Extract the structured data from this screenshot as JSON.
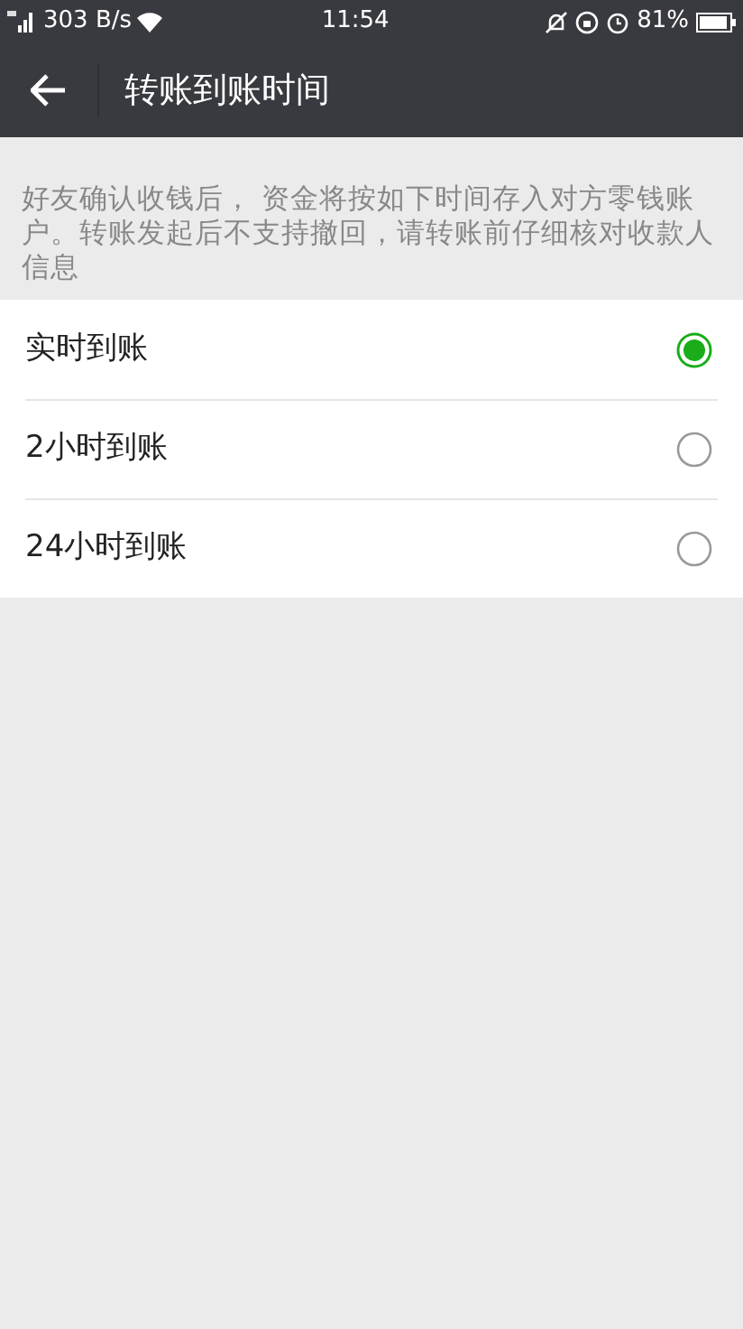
{
  "status_bar": {
    "speed": "303 B/s",
    "time": "11:54",
    "battery": "81%"
  },
  "header": {
    "title": "转账到账时间"
  },
  "description": "好友确认收钱后， 资金将按如下时间存入对方零钱账户。转账发起后不支持撤回，请转账前仔细核对收款人信息",
  "options": [
    {
      "label": "实时到账",
      "selected": true
    },
    {
      "label": "2小时到账",
      "selected": false
    },
    {
      "label": "24小时到账",
      "selected": false
    }
  ]
}
